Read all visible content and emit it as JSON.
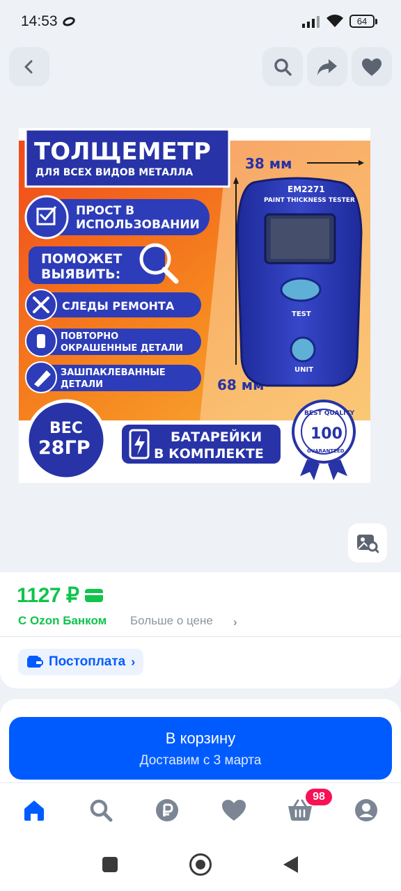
{
  "status_bar": {
    "time": "14:53",
    "battery": "64"
  },
  "gallery": {
    "icons": [
      "back-icon",
      "search-icon",
      "share-icon",
      "heart-icon",
      "image-search-icon"
    ],
    "promo": {
      "title": "ТОЛЩЕМЕТР",
      "subtitle": "ДЛЯ ВСЕХ ВИДОВ МЕТАЛЛА",
      "width_label": "38 мм",
      "height_label": "68 мм",
      "feature_easy_line1": "ПРОСТ В",
      "feature_easy_line2": "ИСПОЛЬЗОВАНИИ",
      "helps_line1": "ПОМОЖЕТ",
      "helps_line2": "ВЫЯВИТЬ:",
      "bullet_1": "СЛЕДЫ РЕМОНТА",
      "bullet_2_line1": "ПОВТОРНО",
      "bullet_2_line2": "ОКРАШЕННЫЕ ДЕТАЛИ",
      "bullet_3_line1": "ЗАШПАКЛЕВАННЫЕ",
      "bullet_3_line2": "ДЕТАЛИ",
      "weight_line1": "ВЕС",
      "weight_line2": "28ГР",
      "battery_line1": "БАТАРЕЙКИ",
      "battery_line2": "В КОМПЛЕКТЕ",
      "device_model": "EM2271",
      "device_name": "PAINT THICKNESS TESTER",
      "device_test": "TEST",
      "device_unit": "UNIT",
      "seal_top": "BEST QUALITY",
      "seal_number": "100",
      "seal_bottom": "GUARANTEED"
    }
  },
  "price": {
    "value": "1127 ₽",
    "bank_label": "С Ozon Банком",
    "more_label": "Больше о цене",
    "more_chevron": "›"
  },
  "postpay": {
    "label": "Постоплата",
    "chevron": "›"
  },
  "cart": {
    "title": "В корзину",
    "subtitle": "Доставим с 3 марта"
  },
  "tabbar": {
    "tabs": [
      "home-icon",
      "search-icon",
      "ruble-icon",
      "favorites-icon",
      "cart-icon",
      "profile-icon"
    ],
    "cart_badge": "98"
  },
  "colors": {
    "brand": "#005bff",
    "price": "#10c44c",
    "badge": "#f91155"
  }
}
